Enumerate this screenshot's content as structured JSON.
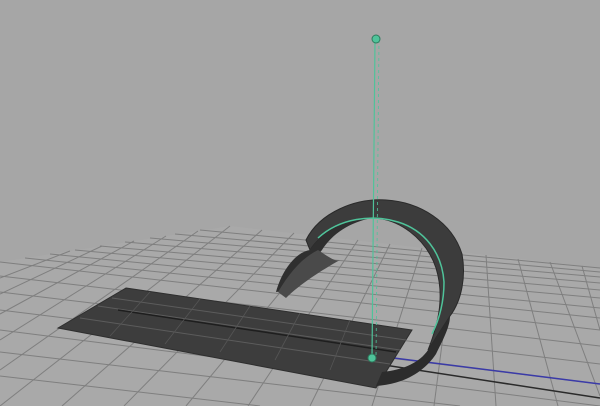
{
  "viewport": {
    "view": "perspective",
    "colors": {
      "background": "#a6a6a6",
      "grid": "#7f7f7f",
      "selection_highlight": "#4fc39a",
      "surface_dark": "#3b3b3b",
      "surface_light": "#5a5a5a",
      "axis_line": "#3a3aa8"
    },
    "objects": [
      {
        "name": "flat-strip-surface",
        "type": "nurbs-plane"
      },
      {
        "name": "bent-strip-surface",
        "type": "nurbs-surface"
      },
      {
        "name": "bend-deformer-handle",
        "type": "deformer-handle",
        "selected": true
      }
    ]
  }
}
